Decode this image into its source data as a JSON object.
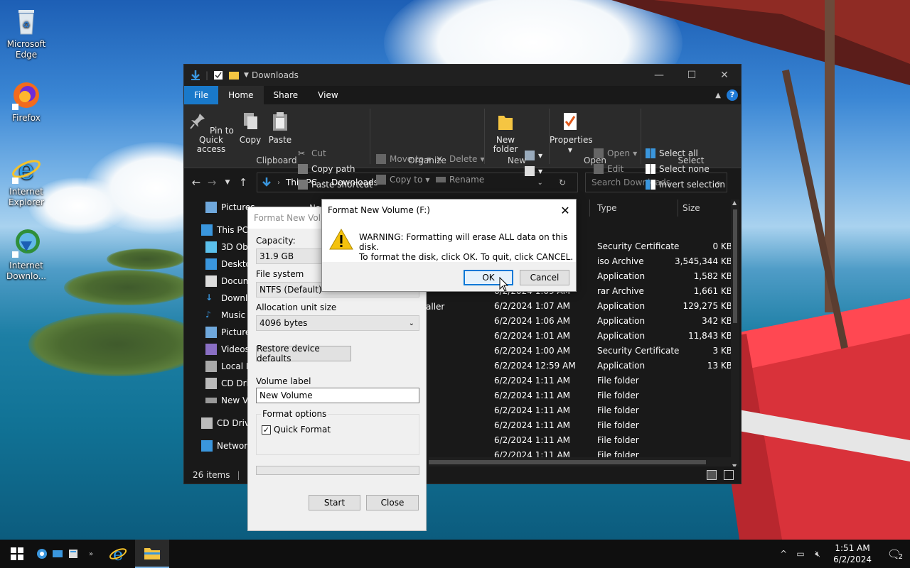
{
  "desktop": {
    "icons": [
      {
        "label": "Microsoft Edge",
        "icon": "recycle-bin-icon"
      },
      {
        "label": "Firefox",
        "icon": "firefox-icon"
      },
      {
        "label": "Internet Explorer",
        "icon": "internet-explorer-icon"
      },
      {
        "label": "Internet Downlo...",
        "icon": "internet-download-manager-icon"
      }
    ]
  },
  "explorer": {
    "title": "Downloads",
    "tabs": [
      "File",
      "Home",
      "Share",
      "View"
    ],
    "ribbon": {
      "clipboard": {
        "group": "Clipboard",
        "pin": "Pin to Quick access",
        "copy": "Copy",
        "paste": "Paste",
        "cut": "Cut",
        "copy_path": "Copy path",
        "paste_shortcut": "Paste shortcut"
      },
      "organize": {
        "group": "Organize",
        "move_to": "Move to",
        "copy_to": "Copy to",
        "delete": "Delete",
        "rename": "Rename"
      },
      "new": {
        "group": "New",
        "new_folder": "New folder"
      },
      "open": {
        "group": "Open",
        "properties": "Properties",
        "open": "Open",
        "edit": "Edit"
      },
      "select": {
        "group": "Select",
        "select_all": "Select all",
        "select_none": "Select none",
        "invert": "Invert selection"
      }
    },
    "address": {
      "root": "This PC",
      "current": "Downloads"
    },
    "search_placeholder": "Search Downloads",
    "nav": [
      "Pictures",
      "This PC",
      "3D Obj",
      "Deskto",
      "Docum",
      "Downlo",
      "Music",
      "Picture",
      "Videos",
      "Local D",
      "CD Driv",
      "New Vo",
      "CD Drive",
      "Network"
    ],
    "columns": {
      "name": "Na",
      "type": "Type",
      "size": "Size"
    },
    "partial_name": "aller",
    "files": [
      {
        "date": "",
        "type": "Security Certificate",
        "size": "0 KB"
      },
      {
        "date": "",
        "type": "iso Archive",
        "size": "3,545,344 KB"
      },
      {
        "date": "",
        "type": "Application",
        "size": "1,582 KB"
      },
      {
        "date": "6/2/2024 1:09 AM",
        "type": "rar Archive",
        "size": "1,661 KB"
      },
      {
        "date": "6/2/2024 1:07 AM",
        "type": "Application",
        "size": "129,275 KB"
      },
      {
        "date": "6/2/2024 1:06 AM",
        "type": "Application",
        "size": "342 KB"
      },
      {
        "date": "6/2/2024 1:01 AM",
        "type": "Application",
        "size": "11,843 KB"
      },
      {
        "date": "6/2/2024 1:00 AM",
        "type": "Security Certificate",
        "size": "3 KB"
      },
      {
        "date": "6/2/2024 12:59 AM",
        "type": "Application",
        "size": "13 KB"
      },
      {
        "date": "6/2/2024 1:11 AM",
        "type": "File folder",
        "size": ""
      },
      {
        "date": "6/2/2024 1:11 AM",
        "type": "File folder",
        "size": ""
      },
      {
        "date": "6/2/2024 1:11 AM",
        "type": "File folder",
        "size": ""
      },
      {
        "date": "6/2/2024 1:11 AM",
        "type": "File folder",
        "size": ""
      },
      {
        "date": "6/2/2024 1:11 AM",
        "type": "File folder",
        "size": ""
      },
      {
        "date": "6/2/2024 1:11 AM",
        "type": "File folder",
        "size": ""
      }
    ],
    "status": "26 items"
  },
  "format_dialog": {
    "title": "Format New Volume",
    "capacity_label": "Capacity:",
    "capacity": "31.9 GB",
    "fs_label": "File system",
    "fs": "NTFS (Default)",
    "alloc_label": "Allocation unit size",
    "alloc": "4096 bytes",
    "restore": "Restore device defaults",
    "volume_label_caption": "Volume label",
    "volume_label": "New Volume",
    "options_caption": "Format options",
    "quick_format": "Quick Format",
    "quick_format_checked": true,
    "progress": 0,
    "start": "Start",
    "close": "Close"
  },
  "warning_dialog": {
    "title": "Format New Volume (F:)",
    "line1": "WARNING: Formatting will erase ALL data on this disk.",
    "line2": "To format the disk, click OK. To quit, click CANCEL.",
    "ok": "OK",
    "cancel": "Cancel"
  },
  "taskbar": {
    "time": "1:51 AM",
    "date": "6/2/2024",
    "notifications": "2"
  },
  "colors": {
    "accent": "#1979ca",
    "warning": "#f4c20d",
    "taskbar": "#0f0f0f"
  }
}
